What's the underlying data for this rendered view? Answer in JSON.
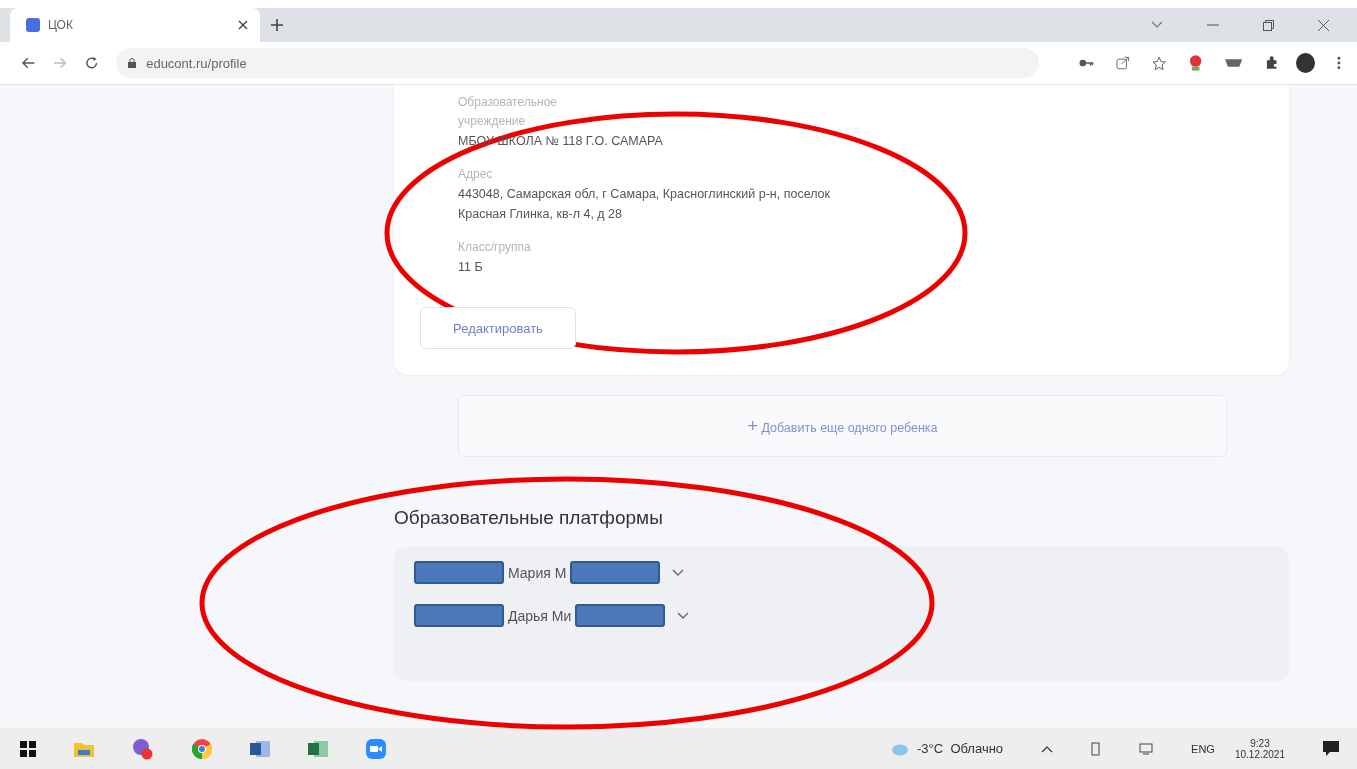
{
  "browser": {
    "tabs": [
      {
        "title": "ЦОК",
        "selected": true
      }
    ],
    "address": "educont.ru/profile"
  },
  "profile_card": {
    "fields": [
      {
        "label": "Образовательное учреждение",
        "value": "МБОУ ШКОЛА № 118 Г.О. САМАРА"
      },
      {
        "label": "Адрес",
        "value": "443048, Самарская обл, г Самара, Красноглинский р-н, поселок Красная Глинка, кв-л 4, д 28"
      },
      {
        "label": "Класс/группа",
        "value": "11 Б"
      }
    ],
    "edit_button": "Редактировать"
  },
  "add_child": {
    "icon": "+",
    "label": "Добавить еще одного ребенка"
  },
  "platforms": {
    "title": "Образовательные платформы",
    "people": [
      {
        "name": "Мария М",
        "expanded": false
      },
      {
        "name": "Дарья Ми",
        "expanded": false
      }
    ]
  },
  "taskbar": {
    "weather": "-3°C  Облачно",
    "language": "ENG",
    "time": "9:23",
    "date": "10.12.2021"
  }
}
